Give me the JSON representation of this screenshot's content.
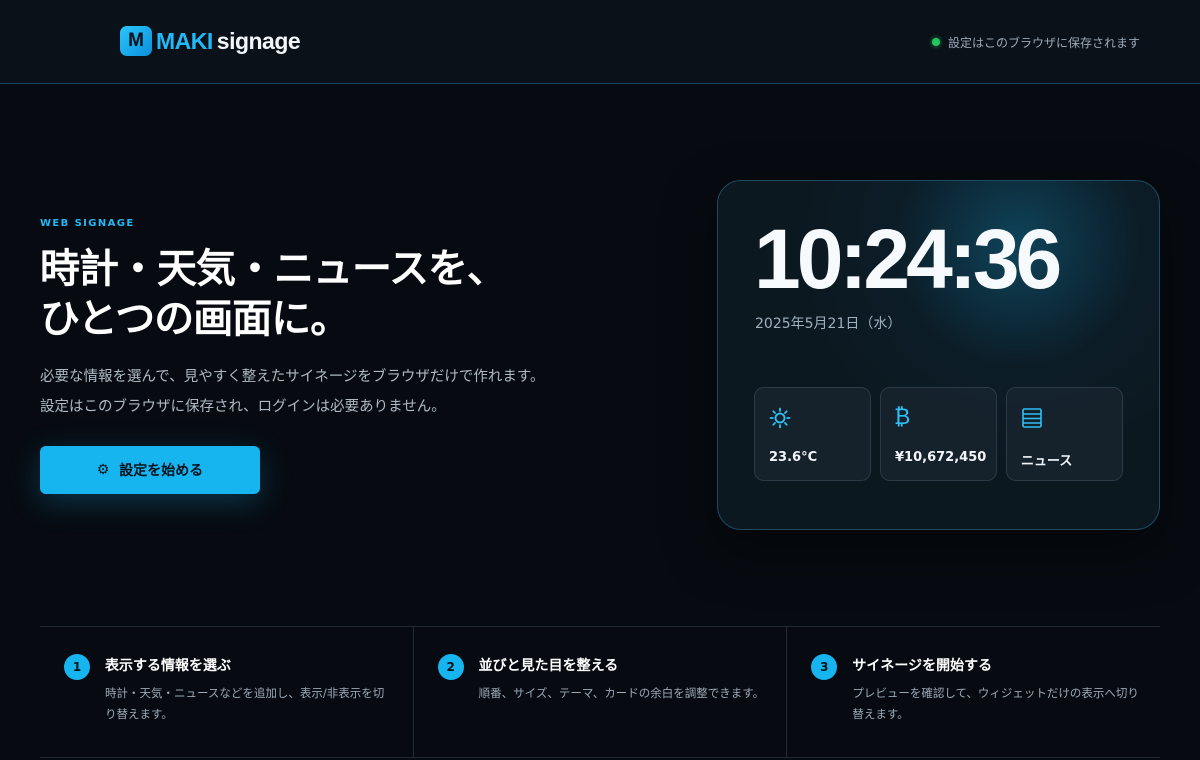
{
  "header": {
    "logo_mark": "M",
    "logo_primary": "MAKI",
    "logo_secondary": "signage",
    "save_status": "設定はこのブラウザに保存されます"
  },
  "hero": {
    "eyebrow": "WEB SIGNAGE",
    "title_line1": "時計・天気・ニュースを、",
    "title_line2": "ひとつの画面に。",
    "desc_line1": "必要な情報を選んで、見やすく整えたサイネージをブラウザだけで作れます。",
    "desc_line2": "設定はこのブラウザに保存され、ログインは必要ありません。",
    "cta_icon": "gear-icon",
    "cta_label": "設定を始める"
  },
  "preview": {
    "time": "10:24:36",
    "date": "2025年5月21日（水）",
    "tiles": [
      {
        "icon": "sun-icon",
        "label": "23.6°C"
      },
      {
        "icon": "bitcoin-icon",
        "label": "¥10,672,450"
      },
      {
        "icon": "news-icon",
        "label": "ニュース"
      }
    ]
  },
  "steps": [
    {
      "num": "1",
      "title": "表示する情報を選ぶ",
      "desc": "時計・天気・ニュースなどを追加し、表示/非表示を切り替えます。"
    },
    {
      "num": "2",
      "title": "並びと見た目を整える",
      "desc": "順番、サイズ、テーマ、カードの余白を調整できます。"
    },
    {
      "num": "3",
      "title": "サイネージを開始する",
      "desc": "プレビューを確認して、ウィジェットだけの表示へ切り替えます。"
    }
  ],
  "colors": {
    "accent": "#16b5f0",
    "status_ok": "#22c55e",
    "background": "#070b11"
  }
}
